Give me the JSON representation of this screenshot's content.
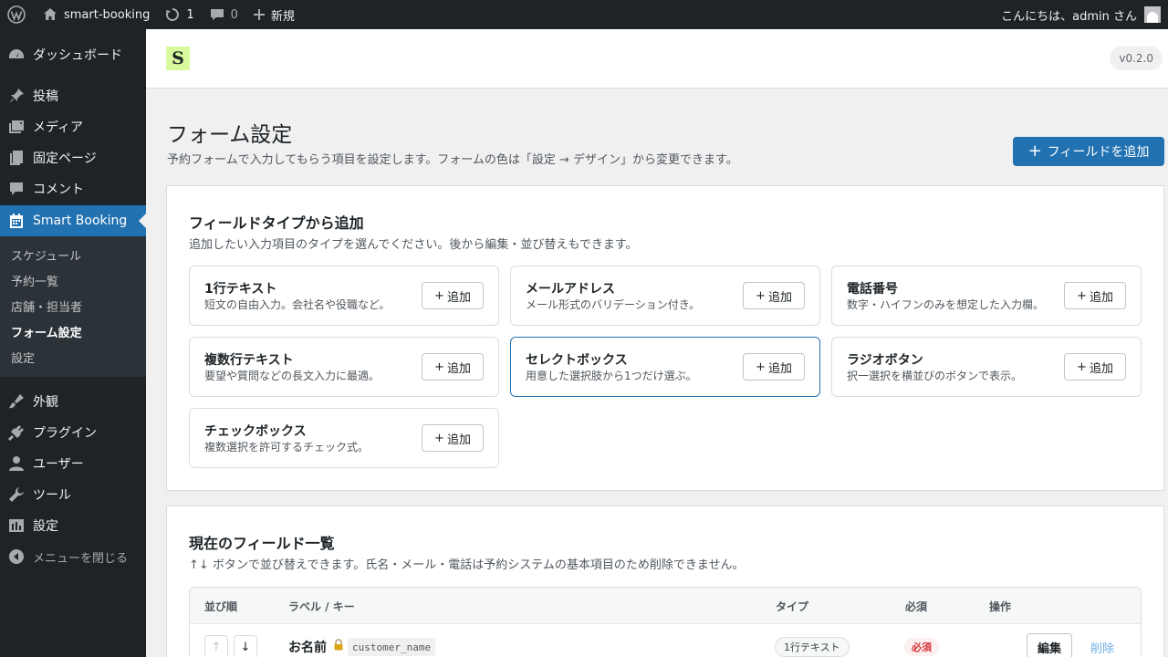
{
  "adminbar": {
    "site_name": "smart-booking",
    "updates_count": "1",
    "comments_count": "0",
    "new_label": "新規",
    "greeting": "こんにちは、admin さん"
  },
  "sidebar": {
    "items_top": [
      {
        "label": "ダッシュボード",
        "icon": "dashboard-icon"
      }
    ],
    "items_mid": [
      {
        "label": "投稿",
        "icon": "pin-icon"
      },
      {
        "label": "メディア",
        "icon": "media-icon"
      },
      {
        "label": "固定ページ",
        "icon": "page-icon"
      },
      {
        "label": "コメント",
        "icon": "comment-icon"
      }
    ],
    "current": {
      "label": "Smart Booking",
      "icon": "calendar-icon"
    },
    "submenu": [
      "スケジュール",
      "予約一覧",
      "店舗・担当者",
      "フォーム設定",
      "設定"
    ],
    "submenu_active": "フォーム設定",
    "items_bottom": [
      {
        "label": "外観",
        "icon": "brush-icon"
      },
      {
        "label": "プラグイン",
        "icon": "plugin-icon"
      },
      {
        "label": "ユーザー",
        "icon": "user-icon"
      },
      {
        "label": "ツール",
        "icon": "wrench-icon"
      },
      {
        "label": "設定",
        "icon": "settings-icon"
      }
    ],
    "collapse_label": "メニューを閉じる"
  },
  "header": {
    "logo_letter": "S",
    "version": "v0.2.0"
  },
  "page": {
    "title": "フォーム設定",
    "description": "予約フォームで入力してもらう項目を設定します。フォームの色は「設定 → デザイン」から変更できます。",
    "add_field_label": "フィールドを追加"
  },
  "field_types": {
    "title": "フィールドタイプから追加",
    "description": "追加したい入力項目のタイプを選んでください。後から編集・並び替えもできます。",
    "add_label": "追加",
    "items": [
      {
        "name": "1行テキスト",
        "desc": "短文の自由入力。会社名や役職など。"
      },
      {
        "name": "メールアドレス",
        "desc": "メール形式のバリデーション付き。"
      },
      {
        "name": "電話番号",
        "desc": "数字・ハイフンのみを想定した入力欄。"
      },
      {
        "name": "複数行テキスト",
        "desc": "要望や質問などの長文入力に最適。"
      },
      {
        "name": "セレクトボックス",
        "desc": "用意した選択肢から1つだけ選ぶ。"
      },
      {
        "name": "ラジオボタン",
        "desc": "択一選択を横並びのボタンで表示。"
      },
      {
        "name": "チェックボックス",
        "desc": "複数選択を許可するチェック式。"
      }
    ]
  },
  "current_fields": {
    "title": "現在のフィールド一覧",
    "description": "↑↓ ボタンで並び替えできます。氏名・メール・電話は予約システムの基本項目のため削除できません。",
    "columns": {
      "order": "並び順",
      "label_key": "ラベル / キー",
      "type": "タイプ",
      "required": "必須",
      "actions": "操作"
    },
    "rows": [
      {
        "label": "お名前",
        "key": "customer_name",
        "type": "1行テキスト",
        "required": "必須",
        "edit": "編集",
        "delete": "削除"
      }
    ]
  },
  "colors": {
    "accent": "#2271b1",
    "sidebar_bg": "#1d2327",
    "logo_bg": "#d9f99d",
    "required": "#d63638"
  }
}
